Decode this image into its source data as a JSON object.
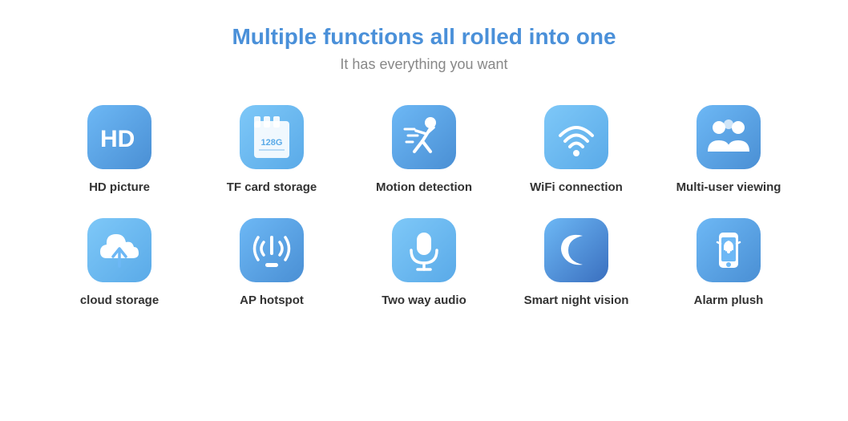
{
  "header": {
    "main_title": "Multiple functions all rolled into one",
    "subtitle": "It has everything you want"
  },
  "features": {
    "row1": [
      {
        "id": "hd-picture",
        "label": "HD picture",
        "icon": "hd"
      },
      {
        "id": "tf-card",
        "label": "TF card storage",
        "icon": "tf"
      },
      {
        "id": "motion",
        "label": "Motion detection",
        "icon": "motion"
      },
      {
        "id": "wifi",
        "label": "WiFi connection",
        "icon": "wifi"
      },
      {
        "id": "multiuser",
        "label": "Multi-user viewing",
        "icon": "multiuser"
      }
    ],
    "row2": [
      {
        "id": "cloud",
        "label": "cloud storage",
        "icon": "cloud"
      },
      {
        "id": "ap",
        "label": "AP hotspot",
        "icon": "ap"
      },
      {
        "id": "audio",
        "label": "Two way audio",
        "icon": "audio"
      },
      {
        "id": "night",
        "label": "Smart night vision",
        "icon": "night"
      },
      {
        "id": "alarm",
        "label": "Alarm plush",
        "icon": "alarm"
      }
    ]
  }
}
